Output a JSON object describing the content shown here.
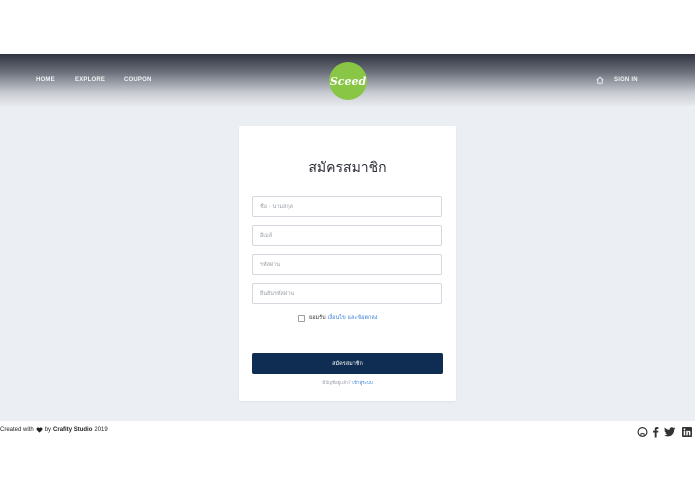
{
  "nav": {
    "home": "HOME",
    "explore": "EXPLORE",
    "coupon": "COUPON",
    "sign_in": "SIGN IN",
    "logo_text": "Sceed"
  },
  "form": {
    "title": "สมัครสมาชิก",
    "name_placeholder": "ชื่อ - นามสกุล",
    "email_placeholder": "อีเมล์",
    "password_placeholder": "รหัสผ่าน",
    "confirm_placeholder": "ยืนยันรหัสผ่าน",
    "agree_prefix": "ยอมรับ",
    "agree_link": "เงื่อนไข และข้อตกลง",
    "submit_label": "สมัครสมาชิก",
    "have_account": "มีบัญชีอยู่แล้ว?",
    "login_link": "เข้าสู่ระบบ"
  },
  "footer": {
    "created_with": "Created with",
    "by": "by",
    "studio": "Crafity Studio",
    "year": "2019"
  },
  "colors": {
    "brand_green": "#8ac645",
    "primary_button": "#0f2d52",
    "link_blue": "#3b7fd6",
    "background": "#ebeef3"
  },
  "icons": [
    "home-icon",
    "heart-icon",
    "github-icon",
    "facebook-icon",
    "twitter-icon",
    "linkedin-icon"
  ]
}
